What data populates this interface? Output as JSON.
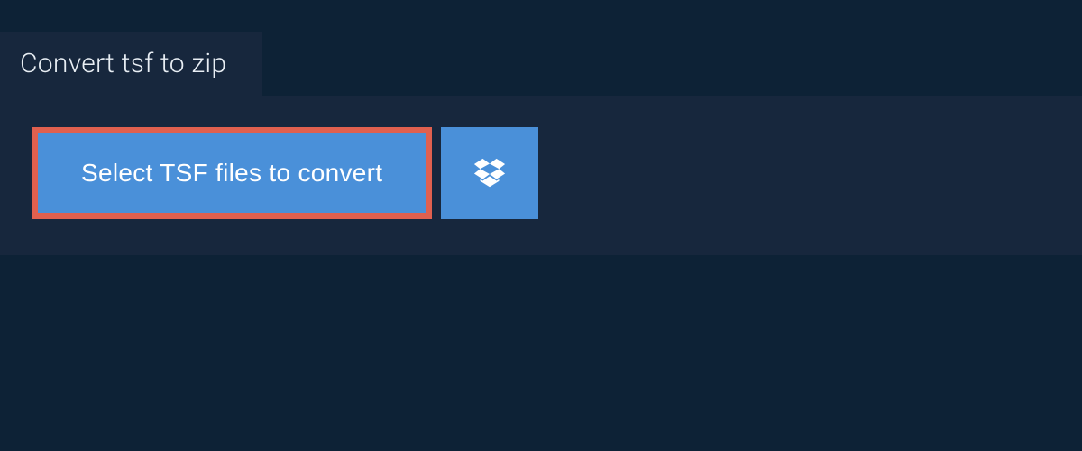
{
  "tab": {
    "label": "Convert tsf to zip"
  },
  "actions": {
    "select_label": "Select TSF files to convert"
  }
}
